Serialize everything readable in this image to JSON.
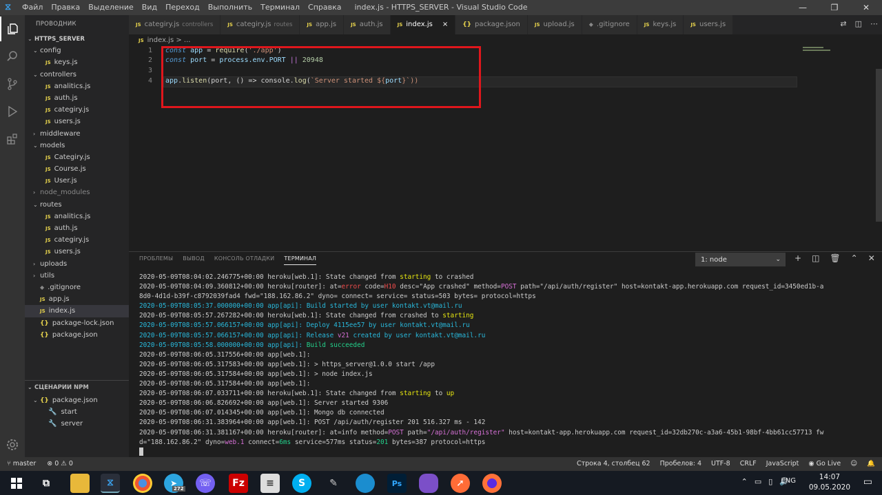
{
  "window": {
    "title": "index.js - HTTPS_SERVER - Visual Studio Code",
    "menu": [
      "Файл",
      "Правка",
      "Выделение",
      "Вид",
      "Переход",
      "Выполнить",
      "Терминал",
      "Справка"
    ],
    "controls": [
      "—",
      "❐",
      "✕"
    ]
  },
  "sidebar": {
    "header": "ПРОВОДНИК",
    "tree": [
      {
        "label": "HTTPS_SERVER",
        "type": "root",
        "depth": 0
      },
      {
        "label": "config",
        "type": "folder-open",
        "depth": 1
      },
      {
        "label": "keys.js",
        "type": "js",
        "depth": 2
      },
      {
        "label": "controllers",
        "type": "folder-open",
        "depth": 1
      },
      {
        "label": "analitics.js",
        "type": "js",
        "depth": 2
      },
      {
        "label": "auth.js",
        "type": "js",
        "depth": 2
      },
      {
        "label": "categiry.js",
        "type": "js",
        "depth": 2
      },
      {
        "label": "users.js",
        "type": "js",
        "depth": 2
      },
      {
        "label": "middleware",
        "type": "folder",
        "depth": 1
      },
      {
        "label": "models",
        "type": "folder-open",
        "depth": 1
      },
      {
        "label": "Categiry.js",
        "type": "js",
        "depth": 2
      },
      {
        "label": "Course.js",
        "type": "js",
        "depth": 2
      },
      {
        "label": "User.js",
        "type": "js",
        "depth": 2
      },
      {
        "label": "node_modules",
        "type": "folder-dim",
        "depth": 1
      },
      {
        "label": "routes",
        "type": "folder-open",
        "depth": 1
      },
      {
        "label": "analitics.js",
        "type": "js",
        "depth": 2
      },
      {
        "label": "auth.js",
        "type": "js",
        "depth": 2
      },
      {
        "label": "categiry.js",
        "type": "js",
        "depth": 2
      },
      {
        "label": "users.js",
        "type": "js",
        "depth": 2
      },
      {
        "label": "uploads",
        "type": "folder",
        "depth": 1
      },
      {
        "label": "utils",
        "type": "folder",
        "depth": 1
      },
      {
        "label": ".gitignore",
        "type": "git",
        "depth": 1
      },
      {
        "label": "app.js",
        "type": "js",
        "depth": 1
      },
      {
        "label": "index.js",
        "type": "js",
        "depth": 1,
        "selected": true
      },
      {
        "label": "package-lock.json",
        "type": "json",
        "depth": 1
      },
      {
        "label": "package.json",
        "type": "json",
        "depth": 1
      }
    ],
    "npm_header": "СЦЕНАРИИ NPM",
    "npm_file": "package.json",
    "npm_scripts": [
      "start",
      "server"
    ]
  },
  "tabs": [
    {
      "label": "categiry.js",
      "desc": "controllers",
      "icon": "JS"
    },
    {
      "label": "categiry.js",
      "desc": "routes",
      "icon": "JS"
    },
    {
      "label": "app.js",
      "desc": "",
      "icon": "JS"
    },
    {
      "label": "auth.js",
      "desc": "",
      "icon": "JS"
    },
    {
      "label": "index.js",
      "desc": "",
      "icon": "JS",
      "active": true,
      "close": "×"
    },
    {
      "label": "package.json",
      "desc": "",
      "icon": "{}"
    },
    {
      "label": "upload.js",
      "desc": "",
      "icon": "JS"
    },
    {
      "label": ".gitignore",
      "desc": "",
      "icon": "◆"
    },
    {
      "label": "keys.js",
      "desc": "",
      "icon": "JS"
    },
    {
      "label": "users.js",
      "desc": "",
      "icon": "JS"
    }
  ],
  "breadcrumb": "index.js > ...",
  "editor": {
    "line_numbers": [
      "1",
      "2",
      "3",
      "4"
    ],
    "line1": {
      "kw": "const",
      "name": "app",
      "eq": "=",
      "fn": "require",
      "arg": "'./app'"
    },
    "line2": {
      "kw": "const",
      "name": "port",
      "eq": "=",
      "expr": "process.env.PORT",
      "or": "||",
      "num": "20948"
    },
    "line4": {
      "obj": "app",
      "fn": "listen",
      "a": "(port, () => console.",
      "log": "log",
      "tpl": "`Server started ${",
      "v": "port",
      "end": "}`))"
    }
  },
  "panel": {
    "tabs": [
      "ПРОБЛЕМЫ",
      "ВЫВОД",
      "КОНСОЛЬ ОТЛАДКИ",
      "ТЕРМИНАЛ"
    ],
    "active_tab": "ТЕРМИНАЛ",
    "terminal_select": "1: node",
    "icons": [
      "+",
      "◫",
      "🗑",
      "⌃",
      "✕"
    ]
  },
  "terminal": {
    "l1": {
      "ts": "2020-05-09T08:04:02.246775+00:00 heroku[web.1]:",
      "t": " State changed from ",
      "a": "starting",
      "b": " to crashed"
    },
    "l2": {
      "ts": "2020-05-09T08:04:09.360812+00:00 heroku[router]:",
      "t1": " at=",
      "err": "error",
      "t2": " code=",
      "code": "H10",
      "t3": " desc=\"App crashed\" method=",
      "meth": "POST",
      "t4": " path=\"/api/auth/register\" host=kontakt-app.herokuapp.com request_id=3450ed1b-a"
    },
    "l3": "8d0-4d1d-b39f-c8792039fad4 fwd=\"188.162.86.2\" dyno= connect= service= status=503 bytes= protocol=https",
    "l4": {
      "ts": "2020-05-09T08:05:37.000000+00:00 app[api]:",
      "t": " Build started by user ",
      "u": "kontakt.vt@mail.ru"
    },
    "l5": {
      "ts": "2020-05-09T08:05:57.267282+00:00 heroku[web.1]:",
      "t": " State changed from crashed to ",
      "a": "starting"
    },
    "l6": {
      "ts": "2020-05-09T08:05:57.066157+00:00 app[api]:",
      "t": " Deploy ",
      "h": "4115ee57",
      "t2": " by user ",
      "u": "kontakt.vt@mail.ru"
    },
    "l7": {
      "ts": "2020-05-09T08:05:57.066157+00:00 app[api]:",
      "t": " Release ",
      "v": "v21",
      "t2": " created by user ",
      "u": "kontakt.vt@mail.ru"
    },
    "l8": {
      "ts": "2020-05-09T08:05:58.000000+00:00 app[api]:",
      "t": " Build succeeded"
    },
    "l9": "2020-05-09T08:06:05.317556+00:00 app[web.1]:",
    "l10": {
      "ts": "2020-05-09T08:06:05.317583+00:00 app[web.1]:",
      "t": " > https_server@1.0.0 start /app"
    },
    "l11": {
      "ts": "2020-05-09T08:06:05.317584+00:00 app[web.1]:",
      "t": " > node index.js"
    },
    "l12": "2020-05-09T08:06:05.317584+00:00 app[web.1]:",
    "l13": {
      "ts": "2020-05-09T08:06:07.033711+00:00 heroku[web.1]:",
      "t": " State changed from ",
      "a": "starting",
      "b": " to ",
      "c": "up"
    },
    "l14": {
      "ts": "2020-05-09T08:06:06.826692+00:00 app[web.1]:",
      "t": " Server started 9306"
    },
    "l15": {
      "ts": "2020-05-09T08:06:07.014345+00:00 app[web.1]:",
      "t": " Mongo db connected"
    },
    "l16": {
      "ts": "2020-05-09T08:06:31.383964+00:00 app[web.1]:",
      "t": " POST /api/auth/register 201 516.327 ms - 142"
    },
    "l17": {
      "ts": "2020-05-09T08:06:31.381167+00:00 heroku[router]:",
      "t1": " at=info method=",
      "meth": "POST",
      "t2": " path=",
      "p": "\"/api/auth/register\"",
      "t3": " host=kontakt-app.herokuapp.com request_id=32db270c-a3a6-45b1-98bf-4bb61cc57713 fw"
    },
    "l18": {
      "t1": "d=\"188.162.86.2\" dyno=",
      "d": "web.1",
      "t2": " connect=",
      "c": "6ms",
      "t3": " service=577ms status=",
      "s": "201",
      "t4": " bytes=387 protocol=https"
    }
  },
  "status": {
    "branch": "master",
    "problems": "⊗ 0 ⚠ 0",
    "position": "Строка 4, столбец 62",
    "spaces": "Пробелов: 4",
    "encoding": "UTF-8",
    "eol": "CRLF",
    "language": "JavaScript",
    "golive": "Go Live"
  },
  "taskbar": {
    "time": "14:07",
    "date": "09.05.2020",
    "lang": "ENG",
    "badge": "272"
  }
}
